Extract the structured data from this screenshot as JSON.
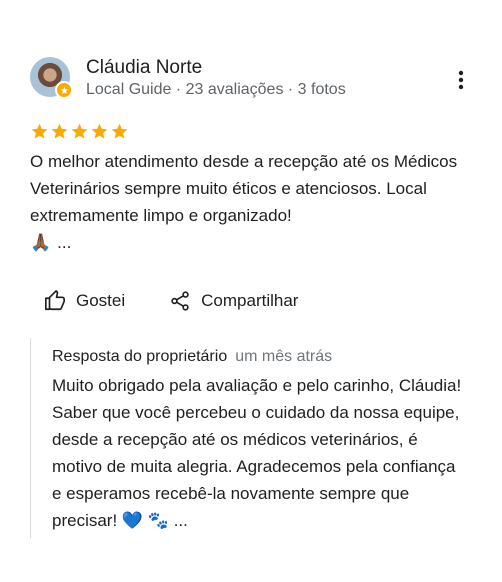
{
  "reviewer": {
    "name": "Cláudia Norte",
    "meta": "Local Guide · 23 avaliações · 3 fotos"
  },
  "rating": {
    "stars": 5,
    "max": 5,
    "color": "#f9ab00"
  },
  "review": {
    "text": "O melhor atendimento desde a recepção até os Médicos Veterinários sempre muito éticos e atenciosos. Local extremamente limpo e organizado!",
    "emoji": "🙏🏾",
    "more": "..."
  },
  "actions": {
    "like_label": "Gostei",
    "share_label": "Compartilhar"
  },
  "owner_reply": {
    "title": "Resposta do proprietário",
    "time": "um mês atrás",
    "text": "Muito obrigado pela avaliação e pelo carinho, Cláudia! Saber que você percebeu o cuidado da nossa equipe, desde a recepção até os médicos veterinários, é motivo de muita alegria. Agradecemos pela confiança e esperamos recebê-la novamente sempre que precisar! 💙 🐾",
    "more": "..."
  },
  "icons": {
    "more": "more-vert-icon",
    "like": "thumb-up-icon",
    "share": "share-icon",
    "badge": "local-guide-badge-icon",
    "star": "star-icon"
  }
}
